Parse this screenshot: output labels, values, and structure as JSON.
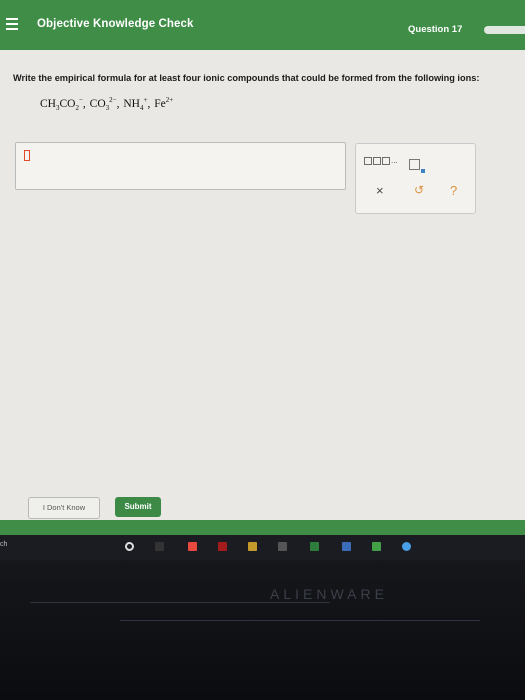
{
  "header": {
    "title": "Objective Knowledge Check",
    "question": "Question 17"
  },
  "prompt": "Write the empirical formula for at least four ionic compounds that could be formed from the following ions:",
  "ions": [
    {
      "base": "CH",
      "sub1": "3",
      "mid": "CO",
      "sub2": "2",
      "sup": "−"
    },
    {
      "base": "CO",
      "sub1": "3",
      "sup": "2−"
    },
    {
      "base": "NH",
      "sub1": "4",
      "sup": "+"
    },
    {
      "base": "Fe",
      "sup": "2+"
    }
  ],
  "toolpanel": {
    "template_suffix": "...",
    "clear": "×",
    "undo": "↺",
    "help": "?"
  },
  "buttons": {
    "dont_know": "I Don't Know",
    "submit": "Submit"
  },
  "taskbar": {
    "search_fragment": "ch"
  },
  "device": {
    "brand": "ALIENWARE"
  },
  "colors": {
    "brand_green": "#3f8d47",
    "cursor_orange": "#e24a2b",
    "help_orange": "#d8923a"
  }
}
